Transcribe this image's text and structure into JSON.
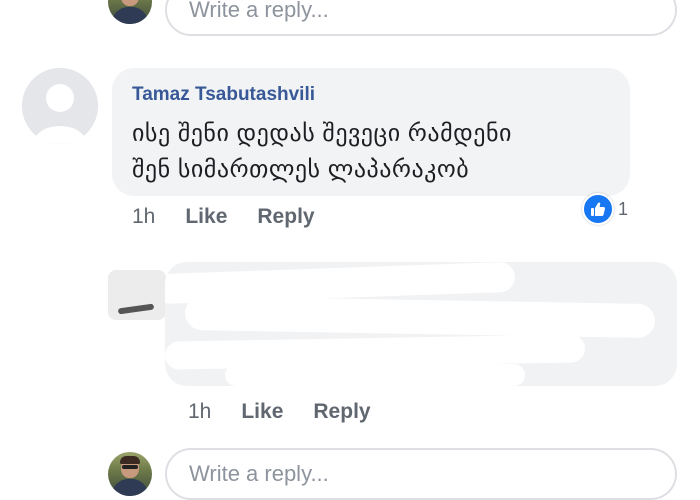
{
  "top_reply": {
    "placeholder": "Write a reply..."
  },
  "comment": {
    "author": "Tamaz Tsabutashvili",
    "text_line1": "ისე შენი დედას შევეცი რამდენი",
    "text_line2": "შენ სიმართლეს ლაპარაკობ",
    "time": "1h",
    "like_label": "Like",
    "reply_label": "Reply",
    "reaction_count": "1"
  },
  "reply_comment": {
    "time": "1h",
    "like_label": "Like",
    "reply_label": "Reply"
  },
  "bottom_reply": {
    "placeholder": "Write a reply..."
  },
  "colors": {
    "author": "#385898",
    "bubble": "#f2f3f5",
    "like_blue": "#1877f2",
    "action_gray": "#606770"
  }
}
